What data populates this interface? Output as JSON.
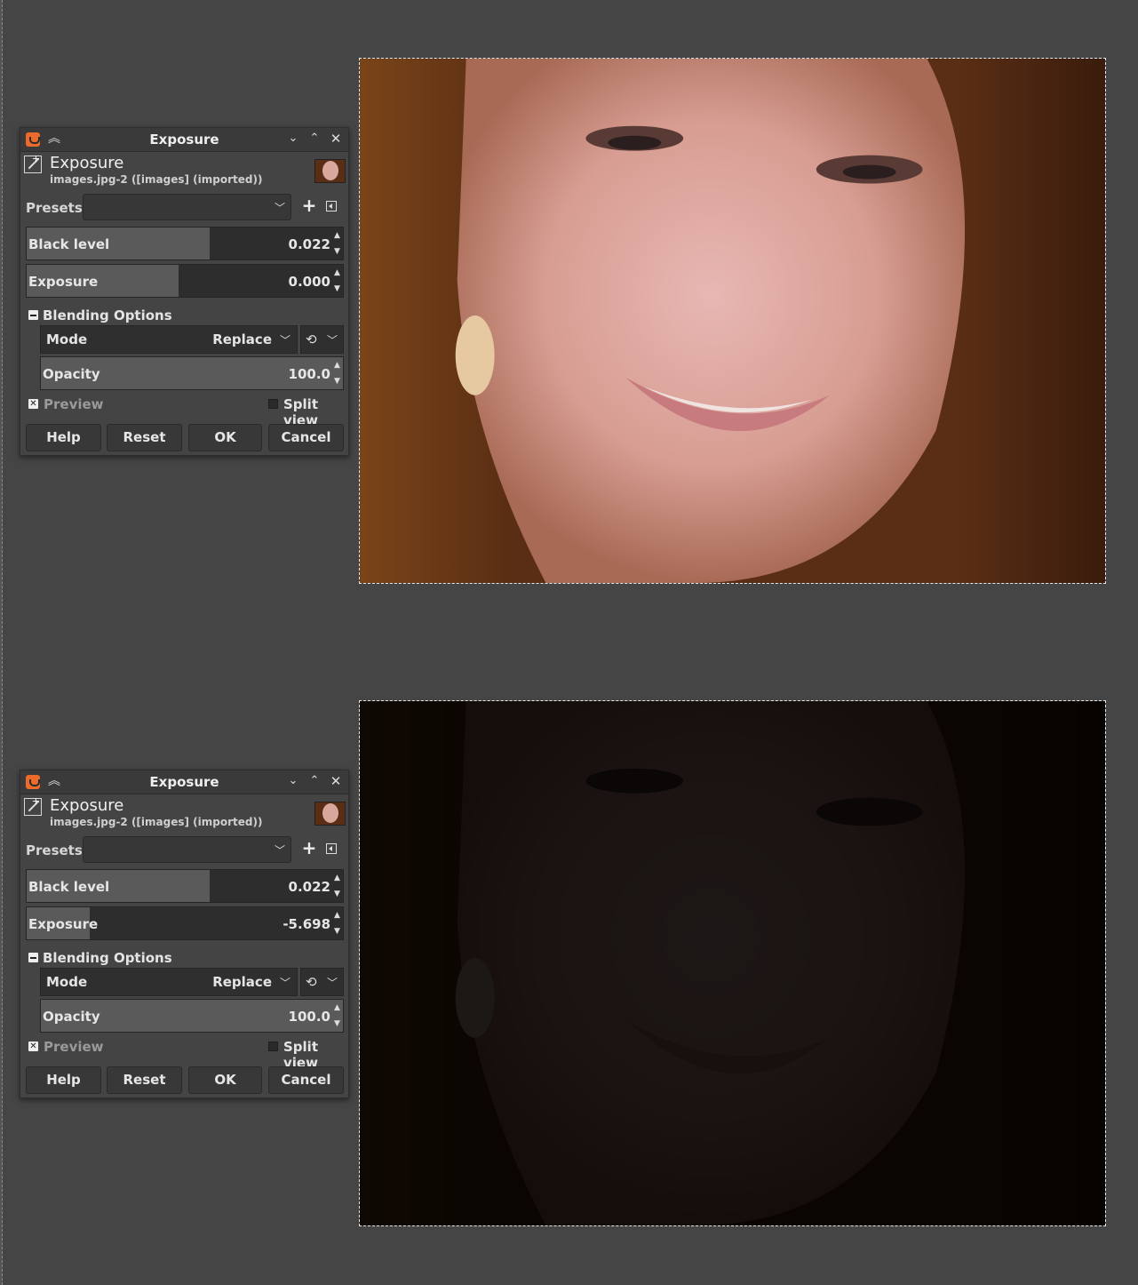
{
  "dialogs": [
    {
      "title": "Exposure",
      "header_title": "Exposure",
      "header_subtitle": "images.jpg-2 ([images] (imported))",
      "presets_label": "Presets:",
      "presets_value": "",
      "black_level": {
        "label": "Black level",
        "value": "0.022",
        "fill_fraction": 0.58
      },
      "exposure": {
        "label": "Exposure",
        "value": "0.000",
        "fill_fraction": 0.48
      },
      "blending_label": "Blending Options",
      "mode_label": "Mode",
      "mode_value": "Replace",
      "opacity": {
        "label": "Opacity",
        "value": "100.0",
        "fill_fraction": 1.0
      },
      "preview_label": "Preview",
      "preview_checked": true,
      "split_view_label": "Split view",
      "split_view_checked": false,
      "buttons": {
        "help": "Help",
        "reset": "Reset",
        "ok": "OK",
        "cancel": "Cancel"
      }
    },
    {
      "title": "Exposure",
      "header_title": "Exposure",
      "header_subtitle": "images.jpg-2 ([images] (imported))",
      "presets_label": "Presets:",
      "presets_value": "",
      "black_level": {
        "label": "Black level",
        "value": "0.022",
        "fill_fraction": 0.58
      },
      "exposure": {
        "label": "Exposure",
        "value": "-5.698",
        "fill_fraction": 0.2
      },
      "blending_label": "Blending Options",
      "mode_label": "Mode",
      "mode_value": "Replace",
      "opacity": {
        "label": "Opacity",
        "value": "100.0",
        "fill_fraction": 1.0
      },
      "preview_label": "Preview",
      "preview_checked": true,
      "split_view_label": "Split view",
      "split_view_checked": false,
      "buttons": {
        "help": "Help",
        "reset": "Reset",
        "ok": "OK",
        "cancel": "Cancel"
      }
    }
  ],
  "colors": {
    "canvas_bg": "#454545",
    "dialog_bg": "#444444",
    "slider_fill": "#5a5a5a",
    "accent": "#ec6a2a"
  },
  "icons": [
    "gimp-app-icon",
    "shade-icon",
    "minimize-icon",
    "maximize-icon",
    "close-icon",
    "exposure-filter-icon",
    "add-preset-icon",
    "preset-menu-icon",
    "mode-switch-icon",
    "chevron-down-icon"
  ]
}
